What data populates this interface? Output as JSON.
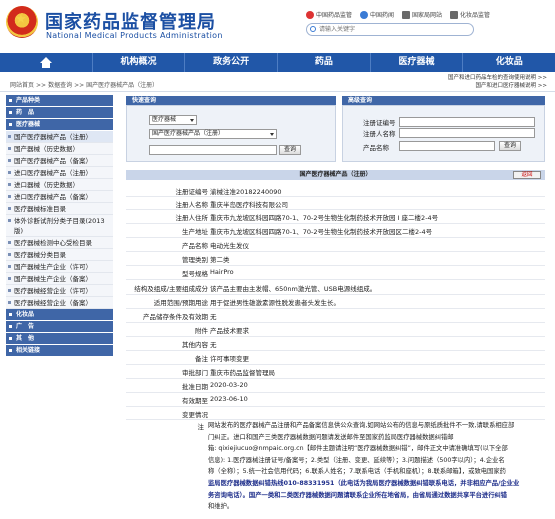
{
  "header": {
    "title": "国家药品监督管理局",
    "subtitle": "National Medical Products Administration",
    "top_links": [
      "中国药品监管",
      "中国药闻",
      "国家局网站",
      "化妆品监管"
    ],
    "search_placeholder": "请输入关键字"
  },
  "nav": [
    "机构概况",
    "政务公开",
    "药品",
    "医疗器械",
    "化妆品"
  ],
  "notices": [
    "国产和进口药品车检的查询使用说明 >>",
    "国产和进口医疗器械说明 >>"
  ],
  "breadcrumb": [
    "网站首页",
    "数据查询",
    "国产医疗器械产品（注册）"
  ],
  "sidebar": {
    "heads": [
      "产品种类",
      "药　品",
      "医疗器械",
      "化妆品",
      "广　告",
      "其　他",
      "相关链接"
    ],
    "items": [
      "国产医疗器械产品（注册）",
      "国产器械（历史数据）",
      "国产医疗器械产品（备案）",
      "进口医疗器械产品（注册）",
      "进口器械（历史数据）",
      "进口医疗器械产品（备案）",
      "医疗器械标准目录",
      "体外诊断试剂分类子目录(2013版)",
      "医疗器械检测中心受检目录",
      "医疗器械分类目录",
      "国产器械生产企业（许可）",
      "国产器械生产企业（备案）",
      "医疗器械经营企业（许可）",
      "医疗器械经营企业（备案）"
    ]
  },
  "quick_search": {
    "title": "快速查询",
    "select1": "医疗器械",
    "select2": "国产医疗器械产品（注册）",
    "button": "查询"
  },
  "advanced_search": {
    "title": "高级查询",
    "labels": [
      "注册证编号",
      "注册人名称",
      "产品名称"
    ],
    "button": "查询"
  },
  "detail": {
    "title": "国产医疗器械产品（注册）",
    "back": "返回",
    "rows": [
      {
        "k": "注册证编号",
        "v": "渝械注准20182240090"
      },
      {
        "k": "注册人名称",
        "v": "重庆半岛医疗科技有限公司"
      },
      {
        "k": "注册人住所",
        "v": "重庆市九龙坡区科园四路70-1、70-2号生物生化制药技术开放园 I 座二楼2-4号"
      },
      {
        "k": "生产地址",
        "v": "重庆市九龙坡区科园四路70-1、70-2号生物生化制药技术开放园区二楼2-4号"
      },
      {
        "k": "产品名称",
        "v": "电动光生发仪"
      },
      {
        "k": "管理类别",
        "v": "第二类"
      },
      {
        "k": "型号规格",
        "v": "HairPro"
      },
      {
        "k": "结构及组成/主要组成成分",
        "v": "该产品主要由主发帽、650nm激光管、USB电源线组成。"
      },
      {
        "k": "适用范围/预期用途",
        "v": "用于促进男性雄激素源性脱发患者头发生长。"
      },
      {
        "k": "产品储存条件及有效期",
        "v": "无"
      },
      {
        "k": "附件",
        "v": "产品技术要求"
      },
      {
        "k": "其他内容",
        "v": "无"
      },
      {
        "k": "备注",
        "v": "许可事项变更"
      },
      {
        "k": "审批部门",
        "v": "重庆市药品监督管理局"
      },
      {
        "k": "批准日期",
        "v": "2020-03-20"
      },
      {
        "k": "有效期至",
        "v": "2023-06-10"
      },
      {
        "k": "变更情况",
        "v": ""
      }
    ],
    "note_label": "注",
    "note_lines": [
      "网站发布的医疗器械产品注册和产品备案信息供公众查询,如网站公布的信息与原纸质批件不一致,请联系相应部",
      "门纠正。进口和国产三类医疗器械数据问题请发送邮件至国家药监局医疗器械数据纠错邮",
      "箱: qixiejiucuo@nmpaic.org.cn【邮件主题请注明“医疗器械数据纠错”，邮件正文中请准确填写(以下全部",
      "信息): 1.医疗器械注册证号/备案号；2.类型（注册、变更、延续等）；3.问题描述（500字以内）；4.企业名",
      "称（全称）；5.统一社会信用代码；6.联系人姓名；7.联系电话（手机和座机）；8.联系邮箱】，或致电国家药",
      "监局医疗器械数据纠错热线010-88331951（此电话为我局医疗器械数据纠错联系电话，并非相应产品/企业业",
      "务咨询电话）。国产一类和二类医疗器械数据问题请联系企业所在地省局，由省局通过数据共享平台进行纠错",
      "和维护。"
    ]
  },
  "colors": {
    "brand": "#1b4fa3",
    "nav": "#2157a8",
    "sidebar_head": "#3f66a7"
  }
}
